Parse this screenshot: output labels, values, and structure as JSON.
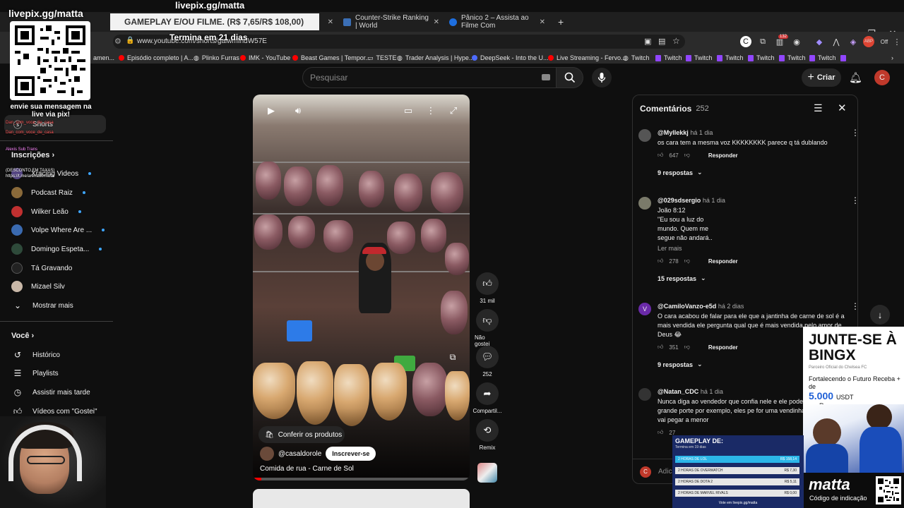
{
  "browser": {
    "tabs": [
      {
        "label": "Counter-Strike Ranking | World"
      },
      {
        "label": "Pânico 2 – Assista ao Filme Com"
      }
    ],
    "url": "www.youtube.com/shorts/gaiwmIndW57E",
    "extensions_badge": "132",
    "bookmarks": [
      {
        "label": "amen..."
      },
      {
        "label": "Episódio completo | A..."
      },
      {
        "label": "Plinko Furras"
      },
      {
        "label": "IMK - YouTube"
      },
      {
        "label": "Beast Games | Tempor..."
      },
      {
        "label": "TESTE"
      },
      {
        "label": "Trader Analysis | Hype..."
      },
      {
        "label": "DeepSeek - Into the U..."
      },
      {
        "label": "Live Streaming - Fervo..."
      },
      {
        "label": "Twitch"
      },
      {
        "label": "Twitch"
      },
      {
        "label": "Twitch"
      },
      {
        "label": "Twitch"
      },
      {
        "label": "Twitch"
      },
      {
        "label": "Twitch"
      },
      {
        "label": "Twitch"
      }
    ]
  },
  "overlay": {
    "title": "livepix.gg/matta",
    "pix_name": "livepix.gg/matta",
    "banner": "GAMEPLAY E/OU FILME. (R$ 7,65/R$ 108,00)",
    "timer": "Termina em 21 dias",
    "pix_message": "envie sua mensagem na live via pix!",
    "chat_lines": [
      "Dan_com_voce_de_casa",
      "Dan_com_voce_de_casa",
      "Alexis Sub Trans",
      "(DESCONTO EM TAXAS)",
      "https://t.me/arenadomatta"
    ]
  },
  "youtube": {
    "search_placeholder": "Pesquisar",
    "create_label": "Criar",
    "avatar_letter": "C",
    "sidebar": {
      "shorts": "Shorts",
      "subscriptions_header": "Inscrições",
      "channels": [
        {
          "name": "Xracing Videos"
        },
        {
          "name": "Podcast Raiz"
        },
        {
          "name": "Wilker Leão"
        },
        {
          "name": "Volpe Where Are ..."
        },
        {
          "name": "Domingo Espeta..."
        },
        {
          "name": "Tá Gravando"
        },
        {
          "name": "Mizael Silv"
        }
      ],
      "show_more": "Mostrar mais",
      "you_header": "Você",
      "you_items": [
        {
          "label": "Histórico"
        },
        {
          "label": "Playlists"
        },
        {
          "label": "Assistir mais tarde"
        },
        {
          "label": "Vídeos com \"Gostei\""
        }
      ]
    },
    "video": {
      "products_label": "Conferir os produtos",
      "channel": "@casaldorole",
      "subscribe_label": "Inscrever-se",
      "title": "Comida de rua - Carne de Sol"
    },
    "actions": {
      "likes": "31 mil",
      "dislike_label": "Não gostei",
      "comments": "252",
      "share_label": "Compartil...",
      "remix_label": "Remix"
    },
    "comments": {
      "title": "Comentários",
      "count": "252",
      "reply_label": "Responder",
      "input_placeholder": "Adicione...",
      "items": [
        {
          "author": "@Myllekkj",
          "time": "há 1 dia",
          "text": "os cara tem a mesma voz KKKKKKKK parece q tá dublando",
          "likes": "647",
          "replies": "9 respostas"
        },
        {
          "author": "@029sdsergio",
          "time": "há 1 dia",
          "text_lines": [
            "João 8:12",
            "\"Eu sou a luz do",
            "mundo. Quem me",
            "segue não andará.."
          ],
          "read_more": "Ler mais",
          "likes": "278",
          "replies": "15 respostas"
        },
        {
          "author": "@CamiloVanzo-e5d",
          "time": "há 2 dias",
          "avatar_letter": "V",
          "text": "O cara acabou de falar para ele que a jantinha de carne de sol é a mais vendida ele pergunta qual que é mais vendida pelo amor de Deus 😂",
          "likes": "351",
          "replies": "9 respostas"
        },
        {
          "author": "@Natan_CDC",
          "time": "há 1 dia",
          "text": "Nunca diga ao vendedor que confia nele e ele pode um açougue de grande porte por exemplo, eles pe for uma vendinha igual essa, ele vai pegar a menor",
          "likes": "27"
        }
      ]
    }
  },
  "ads": {
    "bingx": {
      "headline": "JUNTE-SE À BINGX",
      "partner": "Parceiro Oficial do Chelsea FC",
      "body": "Fortalecendo o Futuro Receba + de",
      "amount": "5.000",
      "unit": "USDT",
      "reward": "em Recompensas"
    },
    "matta": {
      "logo": "matta",
      "subtitle": "Código de indicação"
    },
    "gameplay": {
      "header": "GAMEPLAY DE:",
      "sub": "Termina em 19 dias",
      "rows": [
        {
          "label": "2 HORAS DE LOL",
          "price": "R$ 158,14"
        },
        {
          "label": "2 HORAS DE OVERWATCH",
          "price": "R$ 7,30"
        },
        {
          "label": "2 HORAS DE DOTA 2",
          "price": "R$ 5,11"
        },
        {
          "label": "2 HORAS DE MARVEL RIVALS",
          "price": "R$ 0,00"
        }
      ],
      "footer": "Vote em livepix.gg/matta"
    }
  },
  "colors": {
    "accent": "#3ea6ff",
    "twitch": "#9146ff",
    "bingx_blue": "#1e5fd6",
    "red": "#ff0000"
  }
}
